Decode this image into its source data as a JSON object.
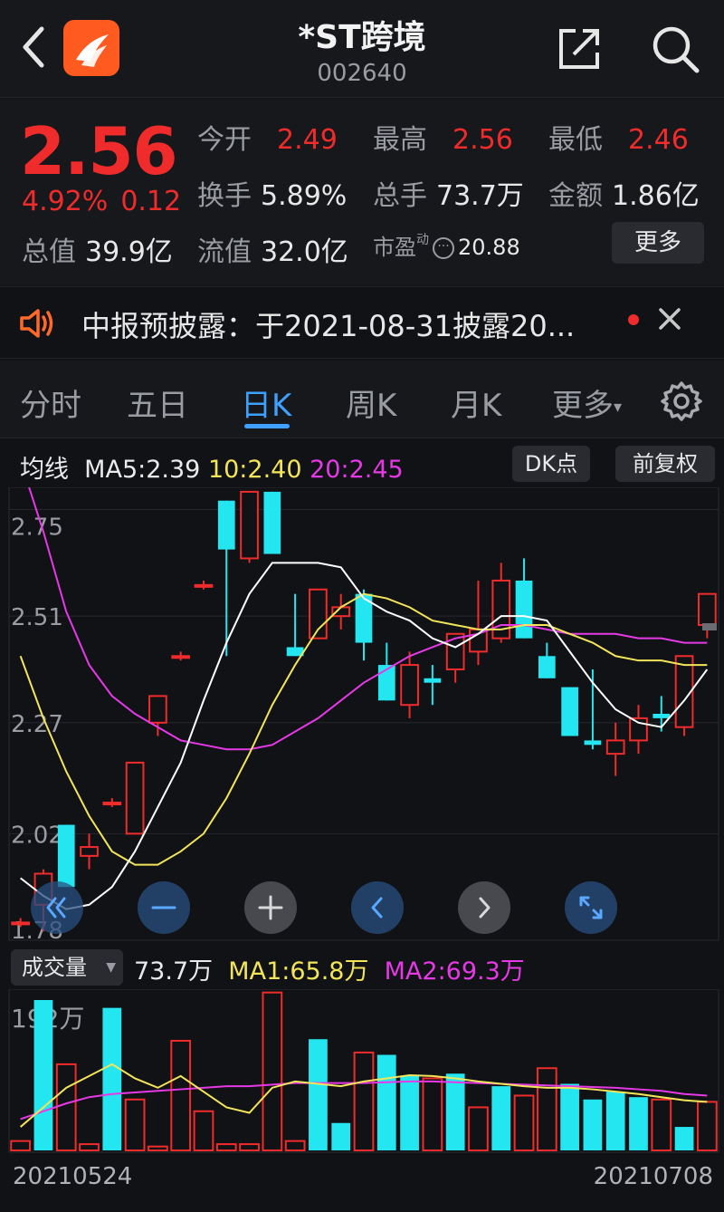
{
  "header": {
    "title": "*ST跨境",
    "code": "002640"
  },
  "quote": {
    "price": "2.56",
    "change_pct": "4.92%",
    "change_abs": "0.12",
    "open_label": "今开",
    "open_value": "2.49",
    "high_label": "最高",
    "high_value": "2.56",
    "low_label": "最低",
    "low_value": "2.46",
    "turnover_label": "换手",
    "turnover_value": "5.89%",
    "volume_label": "总手",
    "volume_value": "73.7万",
    "amount_label": "金额",
    "amount_value": "1.86亿",
    "mktcap_label": "总值",
    "mktcap_value": "39.9亿",
    "float_label": "流值",
    "float_value": "32.0亿",
    "pe_label": "市盈",
    "pe_sup": "动",
    "pe_value": "20.88",
    "more_label": "更多"
  },
  "notice": {
    "text": "中报预披露：于2021-08-31披露20..."
  },
  "tabs": {
    "t1": "分时",
    "t2": "五日",
    "t3": "日K",
    "t4": "周K",
    "t5": "月K",
    "t6": "更多"
  },
  "ma": {
    "label": "均线",
    "ma5": "MA5:2.39",
    "ma10": "10:2.40",
    "ma20": "20:2.45",
    "dk_label": "DK点",
    "adjust_label": "前复权"
  },
  "volume": {
    "select_label": "成交量",
    "value": "73.7万",
    "ma1": "MA1:65.8万",
    "ma2": "MA2:69.3万",
    "max_label": "192万"
  },
  "dates": {
    "start": "20210524",
    "end": "20210708"
  },
  "colors": {
    "up": "#ef2b2b",
    "down": "#24e6f0",
    "ma5": "#ffffff",
    "ma10": "#f3e55a",
    "ma20": "#e639e6",
    "accent": "#3ea0ff"
  },
  "chart_data": {
    "type": "candlestick",
    "y_ticks": [
      "2.75",
      "2.51",
      "2.27",
      "2.02",
      "1.78"
    ],
    "ylim": [
      1.78,
      2.8
    ],
    "candles": [
      {
        "o": 1.82,
        "c": 1.82,
        "h": 1.83,
        "l": 1.81
      },
      {
        "o": 1.86,
        "c": 1.93,
        "h": 1.94,
        "l": 1.8
      },
      {
        "o": 2.04,
        "c": 1.9,
        "h": 2.04,
        "l": 1.9
      },
      {
        "o": 1.97,
        "c": 1.99,
        "h": 2.02,
        "l": 1.94
      },
      {
        "o": 2.09,
        "c": 2.09,
        "h": 2.1,
        "l": 2.08
      },
      {
        "o": 2.02,
        "c": 2.18,
        "h": 2.18,
        "l": 2.02
      },
      {
        "o": 2.27,
        "c": 2.33,
        "h": 2.33,
        "l": 2.24
      },
      {
        "o": 2.42,
        "c": 2.42,
        "h": 2.43,
        "l": 2.41
      },
      {
        "o": 2.58,
        "c": 2.58,
        "h": 2.59,
        "l": 2.57
      },
      {
        "o": 2.77,
        "c": 2.66,
        "h": 2.77,
        "l": 2.42
      },
      {
        "o": 2.64,
        "c": 2.79,
        "h": 2.79,
        "l": 2.63
      },
      {
        "o": 2.79,
        "c": 2.65,
        "h": 2.79,
        "l": 2.65
      },
      {
        "o": 2.44,
        "c": 2.42,
        "h": 2.56,
        "l": 2.42
      },
      {
        "o": 2.46,
        "c": 2.57,
        "h": 2.57,
        "l": 2.46
      },
      {
        "o": 2.51,
        "c": 2.53,
        "h": 2.56,
        "l": 2.48
      },
      {
        "o": 2.56,
        "c": 2.45,
        "h": 2.57,
        "l": 2.41
      },
      {
        "o": 2.4,
        "c": 2.32,
        "h": 2.45,
        "l": 2.32
      },
      {
        "o": 2.31,
        "c": 2.4,
        "h": 2.43,
        "l": 2.28
      },
      {
        "o": 2.37,
        "c": 2.36,
        "h": 2.4,
        "l": 2.31
      },
      {
        "o": 2.39,
        "c": 2.47,
        "h": 2.47,
        "l": 2.36
      },
      {
        "o": 2.43,
        "c": 2.48,
        "h": 2.59,
        "l": 2.4
      },
      {
        "o": 2.46,
        "c": 2.59,
        "h": 2.63,
        "l": 2.45
      },
      {
        "o": 2.59,
        "c": 2.46,
        "h": 2.64,
        "l": 2.46
      },
      {
        "o": 2.42,
        "c": 2.37,
        "h": 2.45,
        "l": 2.37
      },
      {
        "o": 2.35,
        "c": 2.24,
        "h": 2.35,
        "l": 2.24
      },
      {
        "o": 2.23,
        "c": 2.22,
        "h": 2.39,
        "l": 2.21
      },
      {
        "o": 2.2,
        "c": 2.23,
        "h": 2.27,
        "l": 2.15
      },
      {
        "o": 2.23,
        "c": 2.28,
        "h": 2.31,
        "l": 2.2
      },
      {
        "o": 2.29,
        "c": 2.28,
        "h": 2.33,
        "l": 2.25
      },
      {
        "o": 2.26,
        "c": 2.42,
        "h": 2.42,
        "l": 2.24
      },
      {
        "o": 2.49,
        "c": 2.56,
        "h": 2.56,
        "l": 2.46
      }
    ],
    "ma5": [
      1.92,
      1.88,
      1.85,
      1.86,
      1.9,
      1.98,
      2.08,
      2.18,
      2.32,
      2.45,
      2.56,
      2.63,
      2.63,
      2.63,
      2.62,
      2.55,
      2.52,
      2.5,
      2.46,
      2.44,
      2.47,
      2.51,
      2.51,
      2.5,
      2.43,
      2.36,
      2.3,
      2.27,
      2.26,
      2.32,
      2.39
    ],
    "ma10": [
      2.42,
      2.28,
      2.16,
      2.06,
      1.98,
      1.95,
      1.95,
      1.98,
      2.02,
      2.1,
      2.2,
      2.31,
      2.4,
      2.48,
      2.53,
      2.56,
      2.55,
      2.53,
      2.5,
      2.49,
      2.48,
      2.48,
      2.49,
      2.49,
      2.47,
      2.45,
      2.42,
      2.41,
      2.41,
      2.4,
      2.4
    ],
    "ma20": [
      2.86,
      2.7,
      2.52,
      2.4,
      2.33,
      2.29,
      2.26,
      2.23,
      2.22,
      2.21,
      2.21,
      2.22,
      2.25,
      2.28,
      2.32,
      2.36,
      2.39,
      2.42,
      2.44,
      2.46,
      2.47,
      2.49,
      2.49,
      2.48,
      2.47,
      2.47,
      2.47,
      2.46,
      2.46,
      2.45,
      2.45
    ],
    "volume_ylim": [
      0,
      192
    ],
    "volumes": [
      {
        "v": 12,
        "up": true
      },
      {
        "v": 192,
        "up": false
      },
      {
        "v": 110,
        "up": true
      },
      {
        "v": 8,
        "up": true
      },
      {
        "v": 182,
        "up": false
      },
      {
        "v": 65,
        "up": true
      },
      {
        "v": 5,
        "up": true
      },
      {
        "v": 140,
        "up": true
      },
      {
        "v": 50,
        "up": true
      },
      {
        "v": 8,
        "up": true
      },
      {
        "v": 8,
        "up": true
      },
      {
        "v": 240,
        "up": true
      },
      {
        "v": 12,
        "up": true
      },
      {
        "v": 142,
        "up": false
      },
      {
        "v": 35,
        "up": false
      },
      {
        "v": 125,
        "up": true
      },
      {
        "v": 122,
        "up": false
      },
      {
        "v": 95,
        "up": false
      },
      {
        "v": 92,
        "up": true
      },
      {
        "v": 98,
        "up": false
      },
      {
        "v": 55,
        "up": true
      },
      {
        "v": 82,
        "up": false
      },
      {
        "v": 70,
        "up": true
      },
      {
        "v": 105,
        "up": true
      },
      {
        "v": 85,
        "up": false
      },
      {
        "v": 65,
        "up": false
      },
      {
        "v": 75,
        "up": false
      },
      {
        "v": 68,
        "up": false
      },
      {
        "v": 65,
        "up": true
      },
      {
        "v": 30,
        "up": false
      },
      {
        "v": 62,
        "up": true
      }
    ],
    "vol_ma1": [
      30,
      55,
      80,
      95,
      110,
      92,
      80,
      95,
      75,
      55,
      48,
      80,
      88,
      85,
      82,
      88,
      92,
      96,
      95,
      92,
      88,
      85,
      82,
      80,
      80,
      78,
      75,
      72,
      68,
      64,
      62
    ],
    "vol_ma2": [
      40,
      50,
      60,
      68,
      72,
      74,
      76,
      78,
      80,
      82,
      82,
      84,
      86,
      86,
      86,
      86,
      87,
      88,
      88,
      87,
      86,
      85,
      84,
      83,
      82,
      81,
      80,
      78,
      76,
      72,
      70
    ]
  }
}
